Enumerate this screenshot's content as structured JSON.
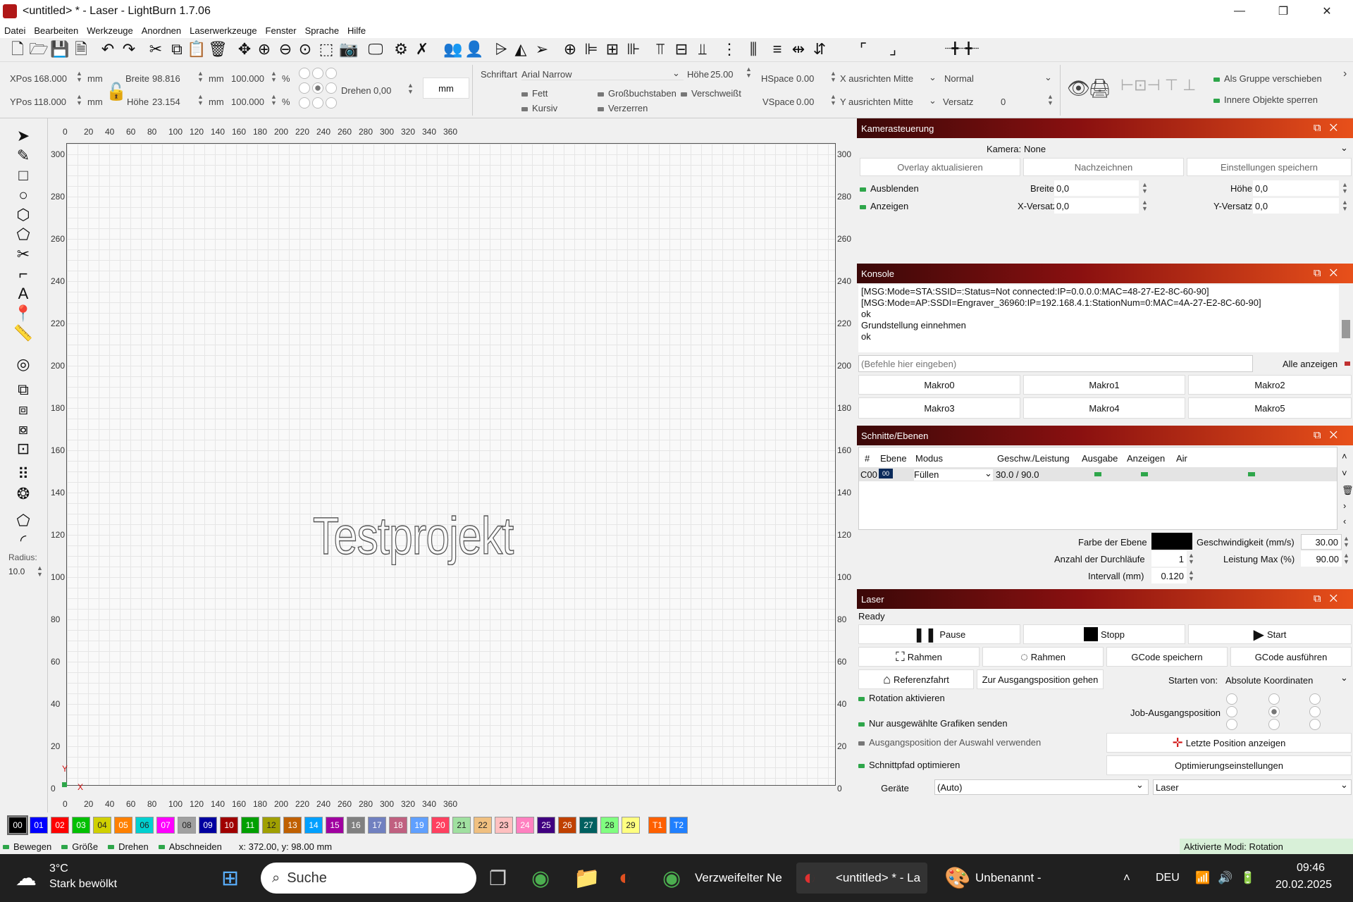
{
  "window": {
    "title": "<untitled> * - Laser - LightBurn 1.7.06",
    "minimize": "—",
    "maximize": "❐",
    "close": "✕"
  },
  "menu": [
    "Datei",
    "Bearbeiten",
    "Werkzeuge",
    "Anordnen",
    "Laserwerkzeuge",
    "Fenster",
    "Sprache",
    "Hilfe"
  ],
  "props": {
    "xpos_label": "XPos",
    "xpos": "168.000",
    "ypos_label": "YPos",
    "ypos": "118.000",
    "unit": "mm",
    "width_label": "Breite",
    "width": "98.816",
    "height_label": "Höhe",
    "height": "23.154",
    "scale_x": "100.000",
    "scale_y": "100.000",
    "percent": "%",
    "rotate_label": "Drehen",
    "rotate": "0,00",
    "units_button": "mm",
    "font_label": "Schriftart",
    "font": "Arial Narrow",
    "textheight_label": "Höhe",
    "textheight": "25.00",
    "hspace_label": "HSpace",
    "hspace": "0.00",
    "vspace_label": "VSpace",
    "vspace": "0.00",
    "bold": "Fett",
    "italic": "Kursiv",
    "upper": "Großbuchstaben",
    "welded": "Verschweißt",
    "distort": "Verzerren",
    "xalign": "X ausrichten Mitte",
    "yalign": "Y ausrichten Mitte",
    "mode": "Normal",
    "offset_label": "Versatz",
    "offset": "0",
    "move_group": "Als Gruppe verschieben",
    "lock_inner": "Innere Objekte sperren"
  },
  "left": {
    "radius_label": "Radius:",
    "radius": "10.0"
  },
  "ruler": {
    "x": [
      "0",
      "20",
      "40",
      "60",
      "80",
      "100",
      "120",
      "140",
      "160",
      "180",
      "200",
      "220",
      "240",
      "260",
      "280",
      "300",
      "320",
      "340",
      "360"
    ],
    "y": [
      "300",
      "280",
      "260",
      "240",
      "220",
      "200",
      "180",
      "160",
      "140",
      "120",
      "100",
      "80",
      "60",
      "40",
      "20",
      "0"
    ],
    "y_axis": "Y",
    "x_axis": "X"
  },
  "canvas_text": "Testprojekt",
  "camera": {
    "title": "Kamerasteuerung",
    "camera_label": "Kamera:",
    "camera": "None",
    "overlay": "Overlay aktualisieren",
    "trace": "Nachzeichnen",
    "save_settings": "Einstellungen speichern",
    "hide": "Ausblenden",
    "show": "Anzeigen",
    "width_label": "Breite",
    "width": "0,0",
    "height_label": "Höhe",
    "height": "0,0",
    "xoff_label": "X-Versatz",
    "xoff": "0,0",
    "yoff_label": "Y-Versatz",
    "yoff": "0,0"
  },
  "console": {
    "title": "Konsole",
    "lines": [
      "[MSG:Mode=STA:SSID=:Status=Not connected:IP=0.0.0.0:MAC=48-27-E2-8C-60-90]",
      "[MSG:Mode=AP:SSDI=Engraver_36960:IP=192.168.4.1:StationNum=0:MAC=4A-27-E2-8C-60-90]",
      "ok",
      "Grundstellung einnehmen",
      "ok"
    ],
    "placeholder": "(Befehle hier eingeben)",
    "show_all": "Alle anzeigen",
    "macros": [
      "Makro0",
      "Makro1",
      "Makro2",
      "Makro3",
      "Makro4",
      "Makro5"
    ]
  },
  "cuts": {
    "title": "Schnitte/Ebenen",
    "cols": [
      "#",
      "Ebene",
      "Modus",
      "Geschw./Leistung",
      "Ausgabe",
      "Anzeigen",
      "Air"
    ],
    "row": {
      "id": "C00",
      "layer": "00",
      "mode": "Füllen",
      "speed_power": "30.0 / 90.0"
    },
    "color_label": "Farbe der Ebene",
    "speed_label": "Geschwindigkeit (mm/s)",
    "speed": "30.00",
    "passes_label": "Anzahl der Durchläufe",
    "passes": "1",
    "power_label": "Leistung Max (%)",
    "power": "90.00",
    "interval_label": "Intervall (mm)",
    "interval": "0.120"
  },
  "laser": {
    "title": "Laser",
    "status": "Ready",
    "pause": "Pause",
    "stop": "Stopp",
    "start": "Start",
    "frame1": "Rahmen",
    "frame2": "Rahmen",
    "save_gcode": "GCode speichern",
    "run_gcode": "GCode ausführen",
    "home": "Referenzfahrt",
    "goto_origin": "Zur Ausgangsposition gehen",
    "start_from_label": "Starten von:",
    "start_from": "Absolute Koordinaten",
    "rotary": "Rotation aktivieren",
    "job_origin": "Job-Ausgangsposition",
    "send_selected": "Nur ausgewählte Grafiken senden",
    "use_selection_origin": "Ausgangsposition der Auswahl verwenden",
    "last_position": "Letzte Position anzeigen",
    "optimize_path": "Schnittpfad optimieren",
    "optim_settings": "Optimierungseinstellungen",
    "devices": "Geräte",
    "device_auto": "(Auto)",
    "device": "Laser"
  },
  "palette": [
    {
      "l": "00",
      "c": "#000000"
    },
    {
      "l": "01",
      "c": "#0000ff"
    },
    {
      "l": "02",
      "c": "#ff0000"
    },
    {
      "l": "03",
      "c": "#00c000"
    },
    {
      "l": "04",
      "c": "#d0d000"
    },
    {
      "l": "05",
      "c": "#ff8000"
    },
    {
      "l": "06",
      "c": "#00d0d0"
    },
    {
      "l": "07",
      "c": "#ff00ff"
    },
    {
      "l": "08",
      "c": "#a0a0a0"
    },
    {
      "l": "09",
      "c": "#0000a0"
    },
    {
      "l": "10",
      "c": "#a00000"
    },
    {
      "l": "11",
      "c": "#00a000"
    },
    {
      "l": "12",
      "c": "#a0a000"
    },
    {
      "l": "13",
      "c": "#c06000"
    },
    {
      "l": "14",
      "c": "#00a0ff"
    },
    {
      "l": "15",
      "c": "#a000a0"
    },
    {
      "l": "16",
      "c": "#808080"
    },
    {
      "l": "17",
      "c": "#7080c0"
    },
    {
      "l": "18",
      "c": "#c06080"
    },
    {
      "l": "19",
      "c": "#60a0ff"
    },
    {
      "l": "20",
      "c": "#ff4060"
    },
    {
      "l": "21",
      "c": "#a0e0a0"
    },
    {
      "l": "22",
      "c": "#f0c080"
    },
    {
      "l": "23",
      "c": "#ffc0c0"
    },
    {
      "l": "24",
      "c": "#ff80c0"
    },
    {
      "l": "25",
      "c": "#400080"
    },
    {
      "l": "26",
      "c": "#c04000"
    },
    {
      "l": "27",
      "c": "#006060"
    },
    {
      "l": "28",
      "c": "#80ff80"
    },
    {
      "l": "29",
      "c": "#ffff80"
    },
    {
      "l": "T1",
      "c": "#ff6000"
    },
    {
      "l": "T2",
      "c": "#2080ff"
    }
  ],
  "status": {
    "move": "Bewegen",
    "size": "Größe",
    "rotate": "Drehen",
    "clip": "Abschneiden",
    "coords": "x: 372.00, y: 98.00 mm",
    "modes": "Aktivierte Modi: Rotation"
  },
  "taskbar": {
    "temp": "3°C",
    "weather": "Stark bewölkt",
    "search": "Suche",
    "chrome_title": "Verzweifelter Ne",
    "lb_title": "<untitled> * - La",
    "paint_title": "Unbenannt -",
    "lang": "DEU",
    "time": "09:46",
    "date": "20.02.2025"
  }
}
